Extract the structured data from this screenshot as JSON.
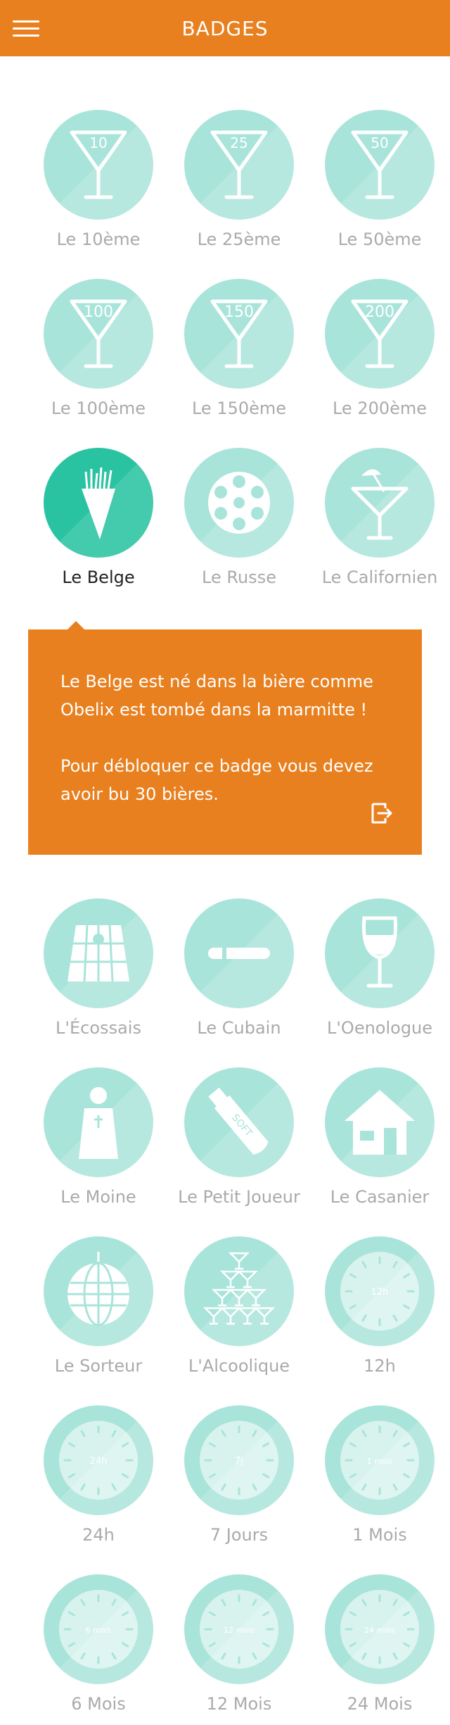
{
  "header": {
    "title": "BADGES",
    "menu_icon": "hamburger-menu-icon"
  },
  "colors": {
    "accent": "#e8801f",
    "badge_locked": "#a9e4da",
    "badge_unlocked": "#2ac3a1",
    "label_locked": "#aaaaaa",
    "label_selected": "#222222"
  },
  "badges": [
    {
      "label": "Le 10ème",
      "icon": "cocktail-glass-icon",
      "glyph": "10"
    },
    {
      "label": "Le 25ème",
      "icon": "cocktail-glass-icon",
      "glyph": "25"
    },
    {
      "label": "Le 50ème",
      "icon": "cocktail-glass-icon",
      "glyph": "50"
    },
    {
      "label": "Le 100ème",
      "icon": "cocktail-glass-icon",
      "glyph": "100"
    },
    {
      "label": "Le 150ème",
      "icon": "cocktail-glass-icon",
      "glyph": "150"
    },
    {
      "label": "Le 200ème",
      "icon": "cocktail-glass-icon",
      "glyph": "200"
    },
    {
      "label": "Le Belge",
      "icon": "fries-cone-icon",
      "selected": true,
      "unlocked": true
    },
    {
      "label": "Le Russe",
      "icon": "revolver-cylinder-icon"
    },
    {
      "label": "Le Californien",
      "icon": "cocktail-umbrella-icon"
    },
    {
      "label": "L'Écossais",
      "icon": "kilt-icon"
    },
    {
      "label": "Le Cubain",
      "icon": "cigar-icon"
    },
    {
      "label": "L'Oenologue",
      "icon": "wine-glass-icon"
    },
    {
      "label": "Le Moine",
      "icon": "monk-icon"
    },
    {
      "label": "Le Petit Joueur",
      "icon": "soft-bottle-icon",
      "glyph": "SOFT"
    },
    {
      "label": "Le Casanier",
      "icon": "house-icon"
    },
    {
      "label": "Le Sorteur",
      "icon": "disco-ball-icon"
    },
    {
      "label": "L'Alcoolique",
      "icon": "glass-pyramid-icon"
    },
    {
      "label": "12h",
      "icon": "clock-icon",
      "glyph": "12h"
    },
    {
      "label": "24h",
      "icon": "clock-icon",
      "glyph": "24h"
    },
    {
      "label": "7 Jours",
      "icon": "clock-icon",
      "glyph": "7j"
    },
    {
      "label": "1 Mois",
      "icon": "clock-icon",
      "glyph": "1 mois"
    },
    {
      "label": "6 Mois",
      "icon": "clock-icon",
      "glyph": "6 mois"
    },
    {
      "label": "12 Mois",
      "icon": "clock-icon",
      "glyph": "12 mois"
    },
    {
      "label": "24 Mois",
      "icon": "clock-icon",
      "glyph": "24 mois"
    }
  ],
  "info_panel": {
    "description": "Le Belge est né dans la bière comme Obelix est tombé dans la marmitte !",
    "unlock_condition": "Pour débloquer ce badge vous devez avoir bu 30 bières.",
    "share_icon": "share-icon"
  }
}
